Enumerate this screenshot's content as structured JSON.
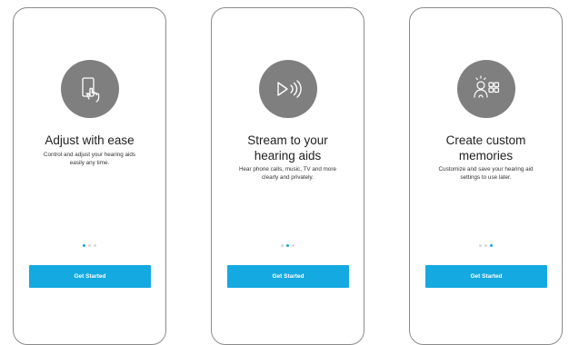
{
  "screens": [
    {
      "icon": "phone-touch-icon",
      "title_lines": [
        "Adjust with ease"
      ],
      "desc_lines": [
        "Control and adjust your hearing aids",
        "easily any time."
      ],
      "active_dot": 0,
      "button_label": "Get Started"
    },
    {
      "icon": "play-stream-icon",
      "title_lines": [
        "Stream to your",
        "hearing aids"
      ],
      "desc_lines": [
        "Hear phone calls, music, TV and more",
        "clearly and privately."
      ],
      "active_dot": 1,
      "button_label": "Get Started"
    },
    {
      "icon": "custom-memories-icon",
      "title_lines": [
        "Create custom",
        "memories"
      ],
      "desc_lines": [
        "Customize and save your hearing aid",
        "settings to use later."
      ],
      "active_dot": 2,
      "button_label": "Get Started"
    }
  ],
  "colors": {
    "accent": "#14a9e0",
    "icon_bg": "#7f7f7f",
    "dot_inactive": "#d7d7d7"
  }
}
